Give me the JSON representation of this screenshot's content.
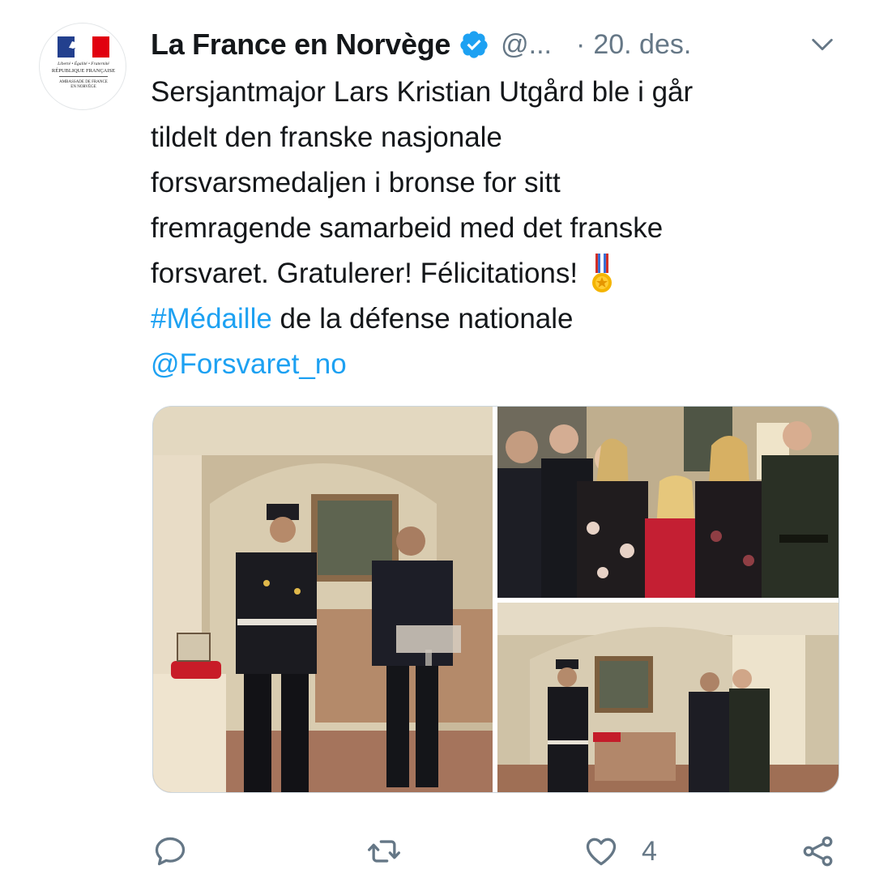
{
  "account": {
    "name": "La France en Norvège",
    "handle": "@...",
    "separator": "·",
    "date": "20. des.",
    "avatar_lines": {
      "motto": "Liberté • Égalité • Fraternité",
      "republic": "RÉPUBLIQUE FRANÇAISE",
      "embassy_1": "AMBASSADE DE FRANCE",
      "embassy_2": "EN NORVÈGE"
    }
  },
  "tweet": {
    "line1": "Sersjantmajor Lars Kristian Utgård ble i går",
    "line2": "tildelt den franske nasjonale",
    "line3": "forsvarsmedaljen i bronse for sitt",
    "line4": "fremragende samarbeid med det franske",
    "line5": "forsvaret. Gratulerer! Félicitations!",
    "hashtag": "#Médaille",
    "hashtag_rest": " de la défense nationale",
    "mention": "@Forsvaret_no"
  },
  "actions": {
    "reply_icon": "reply-icon",
    "retweet_icon": "retweet-icon",
    "like_icon": "heart-icon",
    "like_count": "4",
    "share_icon": "share-icon"
  },
  "colors": {
    "link": "#1da1f2",
    "secondary_text": "#657786",
    "primary_text": "#14171a",
    "verified": "#1da1f2"
  }
}
